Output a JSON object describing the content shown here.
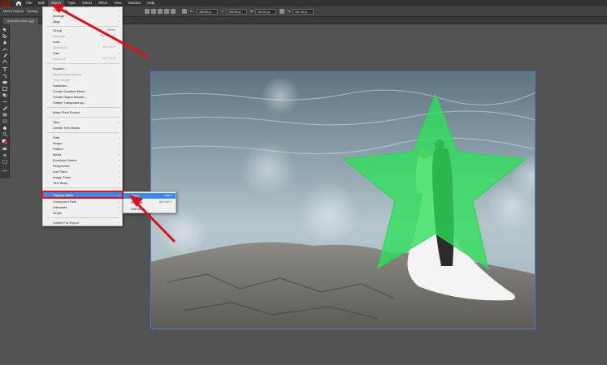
{
  "menubar": {
    "items": [
      "File",
      "Edit",
      "Object",
      "Type",
      "Select",
      "Effect",
      "View",
      "Window",
      "Help"
    ]
  },
  "controlbar": {
    "mixed_objects": "Mixed Objects",
    "opacity": "Opacity",
    "x_value": "308.86 px",
    "y_value": "208.08 px",
    "w_value": "301.81 px",
    "h_value": "401.59 px"
  },
  "doc_tab": "example-photo.jpg",
  "object_menu": {
    "items": [
      {
        "label": "Transform",
        "shortcut": "",
        "submenu": true,
        "disabled": false
      },
      {
        "label": "Arrange",
        "shortcut": "",
        "submenu": true,
        "disabled": false
      },
      {
        "label": "Align",
        "shortcut": "",
        "submenu": true,
        "disabled": false
      },
      {
        "label": "Group",
        "shortcut": "Ctrl+G",
        "submenu": false,
        "disabled": false
      },
      {
        "label": "Ungroup",
        "shortcut": "Shift+Ctrl+G",
        "submenu": false,
        "disabled": true
      },
      {
        "label": "Lock",
        "shortcut": "",
        "submenu": true,
        "disabled": false
      },
      {
        "label": "Unlock All",
        "shortcut": "Alt+Ctrl+2",
        "submenu": false,
        "disabled": true
      },
      {
        "label": "Hide",
        "shortcut": "",
        "submenu": true,
        "disabled": false
      },
      {
        "label": "Show All",
        "shortcut": "Alt+Ctrl+3",
        "submenu": false,
        "disabled": true
      },
      {
        "label": "Expand...",
        "shortcut": "",
        "submenu": false,
        "disabled": false
      },
      {
        "label": "Expand Appearance",
        "shortcut": "",
        "submenu": false,
        "disabled": true
      },
      {
        "label": "Crop Image",
        "shortcut": "",
        "submenu": false,
        "disabled": true
      },
      {
        "label": "Rasterize...",
        "shortcut": "",
        "submenu": false,
        "disabled": false
      },
      {
        "label": "Create Gradient Mesh...",
        "shortcut": "",
        "submenu": false,
        "disabled": false
      },
      {
        "label": "Create Object Mosaic...",
        "shortcut": "",
        "submenu": false,
        "disabled": false
      },
      {
        "label": "Flatten Transparency...",
        "shortcut": "",
        "submenu": false,
        "disabled": false
      },
      {
        "label": "Make Pixel Perfect",
        "shortcut": "",
        "submenu": false,
        "disabled": false
      },
      {
        "label": "Slice",
        "shortcut": "",
        "submenu": true,
        "disabled": false
      },
      {
        "label": "Create Trim Marks",
        "shortcut": "",
        "submenu": false,
        "disabled": false
      },
      {
        "label": "Path",
        "shortcut": "",
        "submenu": true,
        "disabled": false
      },
      {
        "label": "Shape",
        "shortcut": "",
        "submenu": true,
        "disabled": false
      },
      {
        "label": "Pattern",
        "shortcut": "",
        "submenu": true,
        "disabled": false
      },
      {
        "label": "Blend",
        "shortcut": "",
        "submenu": true,
        "disabled": false
      },
      {
        "label": "Envelope Distort",
        "shortcut": "",
        "submenu": true,
        "disabled": false
      },
      {
        "label": "Perspective",
        "shortcut": "",
        "submenu": true,
        "disabled": false
      },
      {
        "label": "Live Paint",
        "shortcut": "",
        "submenu": true,
        "disabled": false
      },
      {
        "label": "Image Trace",
        "shortcut": "",
        "submenu": true,
        "disabled": false
      },
      {
        "label": "Text Wrap",
        "shortcut": "",
        "submenu": true,
        "disabled": false
      },
      {
        "label": "Clipping Mask",
        "shortcut": "",
        "submenu": true,
        "disabled": false,
        "highlighted": true
      },
      {
        "label": "Compound Path",
        "shortcut": "",
        "submenu": true,
        "disabled": false
      },
      {
        "label": "Artboards",
        "shortcut": "",
        "submenu": true,
        "disabled": false
      },
      {
        "label": "Graph",
        "shortcut": "",
        "submenu": true,
        "disabled": false
      },
      {
        "label": "Collect For Export",
        "shortcut": "",
        "submenu": true,
        "disabled": false
      }
    ]
  },
  "clipping_submenu": {
    "items": [
      {
        "label": "Make",
        "shortcut": "Ctrl+7",
        "highlighted": true
      },
      {
        "label": "Release",
        "shortcut": "Alt+Ctrl+7",
        "highlighted": false
      },
      {
        "label": "Edit Mask",
        "shortcut": "",
        "highlighted": false
      }
    ]
  },
  "colors": {
    "annotation_red": "#d7131d",
    "menu_highlight": "#3d8be5",
    "star_green": "#2ee05a"
  }
}
